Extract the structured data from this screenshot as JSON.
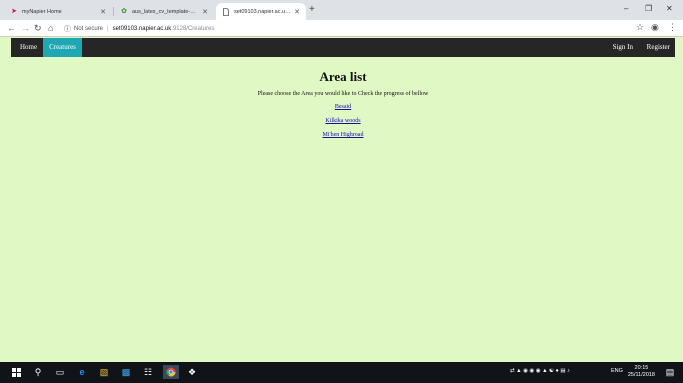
{
  "browser": {
    "tabs": [
      {
        "title": "myNapier Home",
        "active": false
      },
      {
        "title": "aus_latex_cv_template-master (",
        "active": false
      },
      {
        "title": "set09103.napier.ac.uk:9128/Crea",
        "active": true
      }
    ],
    "address": {
      "security_label": "Not secure",
      "host": "set09103.napier.ac.uk",
      "path": ":9128/Creatures"
    }
  },
  "site": {
    "nav": {
      "home": "Home",
      "creatures": "Creatures",
      "sign_in": "Sign In",
      "register": "Register"
    },
    "heading": "Area list",
    "intro": "Please choose the Area you would like to Check the progress of bellow",
    "areas": [
      "Besaid",
      "Kilkika woods",
      "Mi'hen Highroad"
    ]
  },
  "taskbar": {
    "lang": "ENG",
    "time": "20:15",
    "date": "25/11/2018"
  },
  "colors": {
    "page_bg": "#dff8c4",
    "navbar_bg": "#262626",
    "active_nav": "#1fa8b3"
  }
}
